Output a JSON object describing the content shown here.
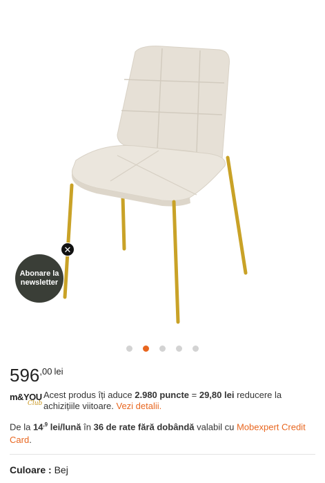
{
  "gallery": {
    "image_alt": "Scaun tapitat bej cu picioare aurii",
    "dot_count": 5,
    "active_index": 1
  },
  "newsletter": {
    "label": "Abonare la newsletter",
    "close_icon": "close-icon"
  },
  "price": {
    "integer": "596",
    "cents": ",00",
    "currency": "lei"
  },
  "loyalty": {
    "logo_text": "m&YOU",
    "logo_sub": "Club",
    "text_prefix": "Acest produs îți aduce ",
    "points": "2.980 puncte",
    "equals": " = ",
    "amount": "29,80 lei",
    "text_suffix": " reducere la achizițiile viitoare. ",
    "details_link": "Vezi detalii."
  },
  "installments": {
    "prefix": "De la ",
    "amount": "14",
    "amount_sup": ",9",
    "per_month": " lei/lună",
    "middle": " în ",
    "count": "36 de rate fără dobândă",
    "suffix": " valabil cu ",
    "card_link": "Mobexpert Credit Card",
    "end": "."
  },
  "color": {
    "label": "Culoare :",
    "value": "Bej"
  },
  "colors": {
    "accent": "#e8661f",
    "badge_bg": "#3a3e37",
    "chair_fabric": "#e8e2d8",
    "chair_legs": "#c9a227"
  }
}
